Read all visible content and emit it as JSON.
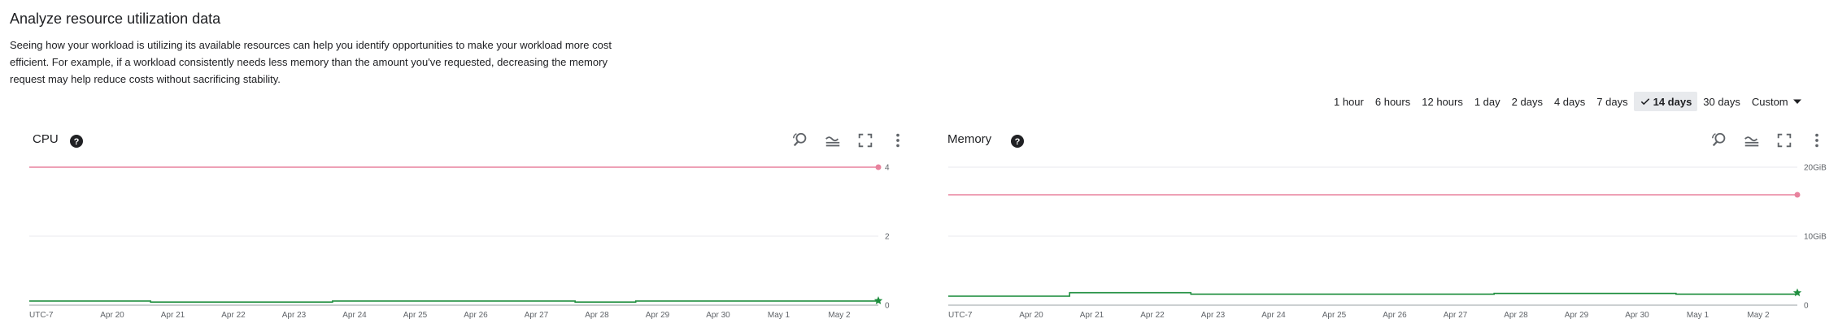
{
  "page": {
    "title": "Analyze resource utilization data",
    "description": "Seeing how your workload is utilizing its available resources can help you identify opportunities to make your workload more cost efficient. For example, if a workload consistently needs less memory than the amount you've requested, decreasing the memory request may help reduce costs without sacrificing stability."
  },
  "time_range": {
    "options": [
      "1 hour",
      "6 hours",
      "12 hours",
      "1 day",
      "2 days",
      "4 days",
      "7 days",
      "14 days",
      "30 days",
      "Custom"
    ],
    "selected": "14 days"
  },
  "colors": {
    "limit_line": "#e8829d",
    "usage_line": "#1e8e3e",
    "grid": "#e8eaed",
    "axis_text": "#5f6368"
  },
  "icons": {
    "help": "help-circle-icon",
    "reset_zoom": "reset-zoom-icon",
    "compare": "compare-icon",
    "fullscreen": "fullscreen-icon",
    "more": "more-vert-icon"
  },
  "chart_data": [
    {
      "type": "line",
      "title": "CPU",
      "x_labels": [
        "UTC-7",
        "Apr 20",
        "Apr 21",
        "Apr 22",
        "Apr 23",
        "Apr 24",
        "Apr 25",
        "Apr 26",
        "Apr 27",
        "Apr 28",
        "Apr 29",
        "Apr 30",
        "May 1",
        "May 2"
      ],
      "y_ticks": [
        "0",
        "2",
        "4"
      ],
      "ylim": [
        0,
        4
      ],
      "grid": true,
      "series": [
        {
          "kind": "limit",
          "values": [
            4,
            4,
            4,
            4,
            4,
            4,
            4,
            4,
            4,
            4,
            4,
            4,
            4,
            4,
            4
          ]
        },
        {
          "kind": "usage",
          "values": [
            0.12,
            0.12,
            0.09,
            0.09,
            0.09,
            0.12,
            0.12,
            0.12,
            0.12,
            0.09,
            0.12,
            0.12,
            0.12,
            0.12,
            0.13
          ]
        }
      ]
    },
    {
      "type": "line",
      "title": "Memory",
      "x_labels": [
        "UTC-7",
        "Apr 20",
        "Apr 21",
        "Apr 22",
        "Apr 23",
        "Apr 24",
        "Apr 25",
        "Apr 26",
        "Apr 27",
        "Apr 28",
        "Apr 29",
        "Apr 30",
        "May 1",
        "May 2"
      ],
      "y_ticks": [
        "0",
        "10GiB",
        "20GiB"
      ],
      "ylim": [
        0,
        20
      ],
      "grid": true,
      "series": [
        {
          "kind": "limit",
          "values": [
            16,
            16,
            16,
            16,
            16,
            16,
            16,
            16,
            16,
            16,
            16,
            16,
            16,
            16,
            16
          ]
        },
        {
          "kind": "usage",
          "values": [
            1.3,
            1.3,
            1.8,
            1.8,
            1.6,
            1.6,
            1.6,
            1.6,
            1.6,
            1.7,
            1.7,
            1.7,
            1.6,
            1.6,
            1.8
          ]
        }
      ]
    }
  ]
}
